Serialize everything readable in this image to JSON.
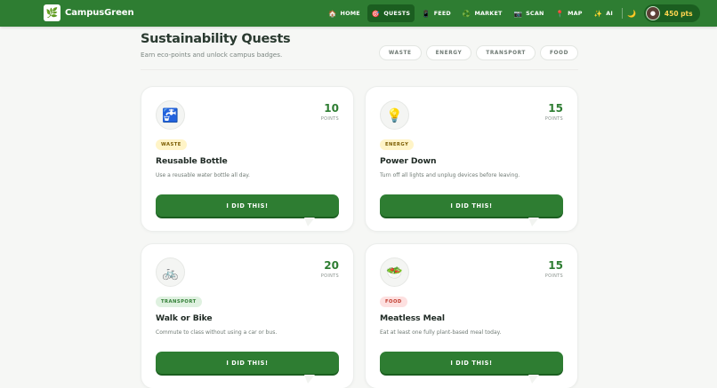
{
  "brand": {
    "name": "CampusGreen",
    "logo_icon": "leaf-icon"
  },
  "nav": {
    "items": [
      {
        "label": "HOME",
        "icon": "🏠",
        "icon_name": "home-icon",
        "active": false
      },
      {
        "label": "QUESTS",
        "icon": "🎯",
        "icon_name": "target-icon",
        "active": true
      },
      {
        "label": "FEED",
        "icon": "📱",
        "icon_name": "phone-icon",
        "active": false
      },
      {
        "label": "MARKET",
        "icon": "♻️",
        "icon_name": "recycle-icon",
        "active": false
      },
      {
        "label": "SCAN",
        "icon": "📷",
        "icon_name": "camera-icon",
        "active": false
      },
      {
        "label": "MAP",
        "icon": "📍",
        "icon_name": "pin-icon",
        "active": false
      },
      {
        "label": "AI",
        "icon": "✨",
        "icon_name": "sparkles-icon",
        "active": false
      }
    ],
    "theme_toggle_icon": "🌙",
    "points": "450 pts"
  },
  "header": {
    "title": "Sustainability Quests",
    "subtitle": "Earn eco-points and unlock campus badges."
  },
  "filters": [
    "WASTE",
    "ENERGY",
    "TRANSPORT",
    "FOOD"
  ],
  "quests": [
    {
      "icon": "🚰",
      "icon_name": "water-bottle-icon",
      "points": "10",
      "points_label": "POINTS",
      "category": "WASTE",
      "title": "Reusable Bottle",
      "description": "Use a reusable water bottle all day.",
      "cta": "I DID THIS!"
    },
    {
      "icon": "💡",
      "icon_name": "lightbulb-icon",
      "points": "15",
      "points_label": "POINTS",
      "category": "ENERGY",
      "title": "Power Down",
      "description": "Turn off all lights and unplug devices before leaving.",
      "cta": "I DID THIS!"
    },
    {
      "icon": "🚲",
      "icon_name": "bicycle-icon",
      "points": "20",
      "points_label": "POINTS",
      "category": "TRANSPORT",
      "title": "Walk or Bike",
      "description": "Commute to class without using a car or bus.",
      "cta": "I DID THIS!"
    },
    {
      "icon": "🥗",
      "icon_name": "salad-icon",
      "points": "15",
      "points_label": "POINTS",
      "category": "FOOD",
      "title": "Meatless Meal",
      "description": "Eat at least one fully plant-based meal today.",
      "cta": "I DID THIS!"
    }
  ],
  "colors": {
    "primary": "#2e7d32",
    "primary_dark": "#1b5e20",
    "points_gold": "#ffd54f"
  }
}
